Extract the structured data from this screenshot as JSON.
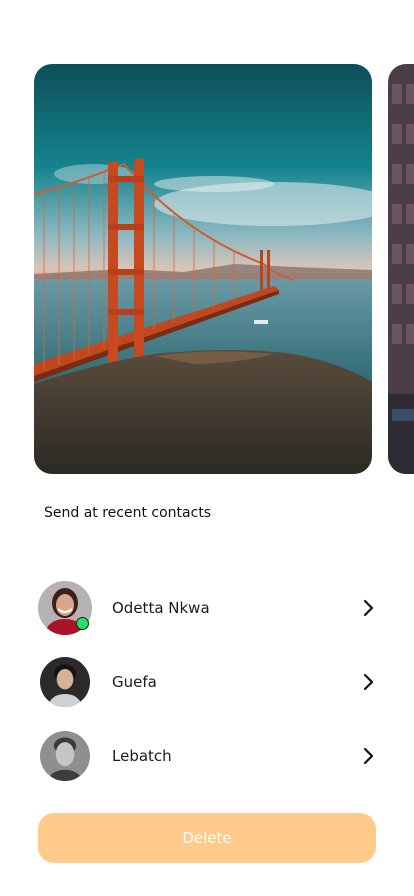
{
  "carousel": {
    "images": [
      {
        "icon": "golden-gate-bridge-photo"
      },
      {
        "icon": "building-photo"
      }
    ]
  },
  "recent_contacts": {
    "title": "Send at recent contacts",
    "contacts": [
      {
        "name": "Odetta Nkwa",
        "online": true
      },
      {
        "name": "Guefa",
        "online": false
      },
      {
        "name": "Lebatch",
        "online": false
      }
    ]
  },
  "actions": {
    "delete_label": "Delete"
  },
  "colors": {
    "delete_bg": "#ffca8a",
    "online": "#20e36b"
  }
}
